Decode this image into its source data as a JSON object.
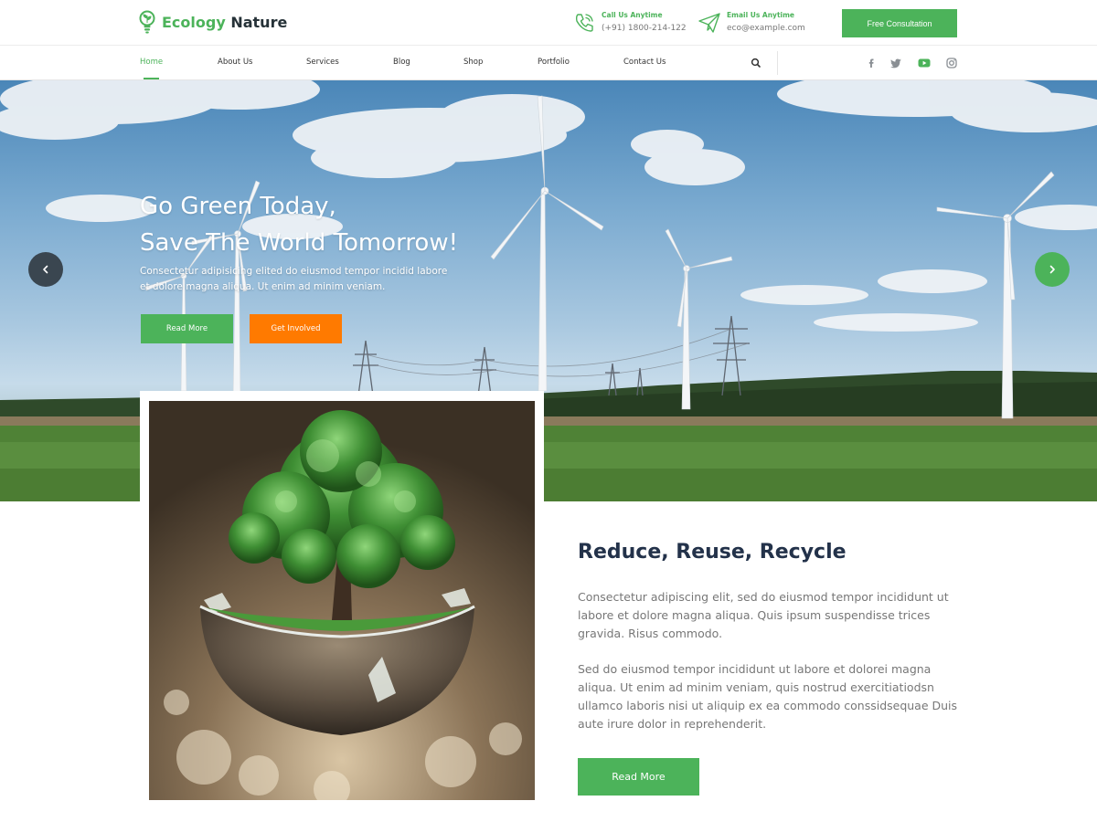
{
  "brand": {
    "name_part1": "Ecology",
    "name_part2": "Nature"
  },
  "contacts": {
    "phone_label": "Call Us Anytime",
    "phone_value": "(+91) 1800-214-122",
    "email_label": "Email Us Anytime",
    "email_value": "eco@example.com"
  },
  "header": {
    "cta_label": "Free Consultation"
  },
  "nav": {
    "items": [
      {
        "label": "Home",
        "active": true
      },
      {
        "label": "About Us"
      },
      {
        "label": "Services"
      },
      {
        "label": "Blog"
      },
      {
        "label": "Shop"
      },
      {
        "label": "Portfolio"
      },
      {
        "label": "Contact Us"
      }
    ],
    "search_icon": "search-icon",
    "social_icons": [
      "facebook-icon",
      "twitter-icon",
      "youtube-icon",
      "instagram-icon"
    ]
  },
  "hero": {
    "title_line1": "Go Green Today,",
    "title_line2": "Save The World Tomorrow!",
    "subtitle_line1": "Consectetur adipisicing elited do eiusmod tempor incidid labore",
    "subtitle_line2": "et dolore magna aliqua. Ut enim ad minim veniam.",
    "btn_primary": "Read More",
    "btn_secondary": "Get Involved",
    "prev_icon": "chevron-left-icon",
    "next_icon": "chevron-right-icon"
  },
  "feature": {
    "title": "Reduce, Reuse, Recycle",
    "paragraph1": "Consectetur adipiscing elit, sed do eiusmod tempor incididunt ut labore et dolore magna aliqua. Quis ipsum suspendisse trices gravida. Risus commodo.",
    "paragraph2": "Sed do eiusmod tempor incididunt ut labore et dolorei magna aliqua. Ut enim ad minim veniam, quis nostrud exercitiatiodsn ullamco laboris nisi ut aliquip ex ea commodo conssidsequae Duis aute irure dolor in reprehenderit.",
    "btn_label": "Read More"
  },
  "colors": {
    "brand_green": "#4cb35a",
    "accent_orange": "#ff7a00",
    "heading_dark": "#23324a",
    "arrow_dark": "#3a4650"
  }
}
